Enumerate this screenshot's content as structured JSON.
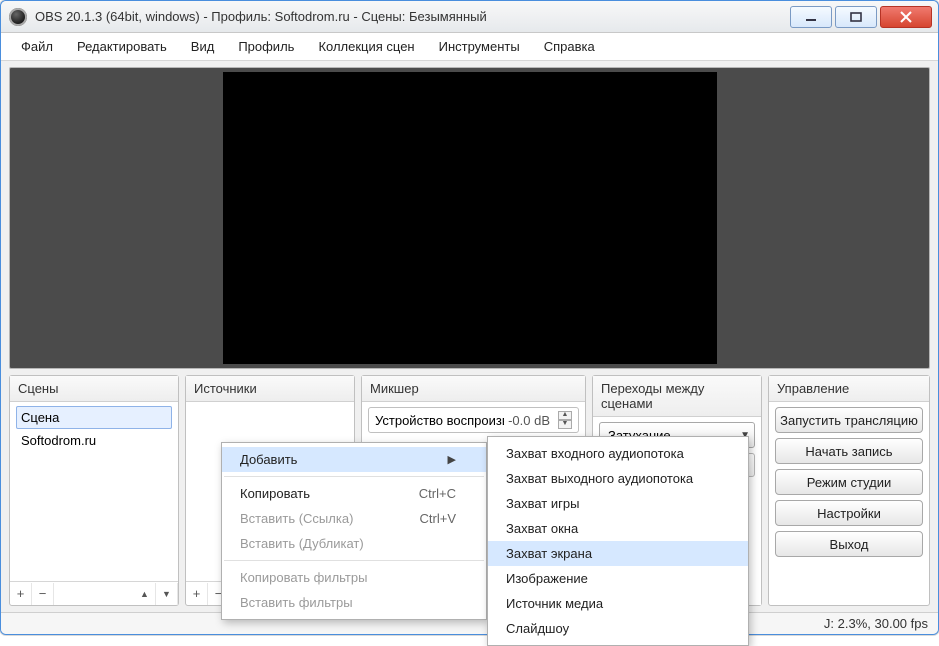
{
  "window": {
    "title": "OBS 20.1.3 (64bit, windows) - Профиль: Softodrom.ru - Сцены: Безымянный"
  },
  "menubar": [
    "Файл",
    "Редактировать",
    "Вид",
    "Профиль",
    "Коллекция сцен",
    "Инструменты",
    "Справка"
  ],
  "panels": {
    "scenes": {
      "title": "Сцены",
      "items": [
        "Сцена",
        "Softodrom.ru"
      ],
      "selected": 0
    },
    "sources": {
      "title": "Источники"
    },
    "mixer": {
      "title": "Микшер",
      "device": "Устройство воспроизведен",
      "db": "-0.0 dB"
    },
    "transitions": {
      "title": "Переходы между сценами",
      "selected": "Затухание"
    },
    "controls": {
      "title": "Управление",
      "buttons": [
        "Запустить трансляцию",
        "Начать запись",
        "Режим студии",
        "Настройки",
        "Выход"
      ]
    }
  },
  "context_menu_1": {
    "items": [
      {
        "label": "Добавить",
        "submenu": true,
        "highlight": true
      },
      {
        "sep": true
      },
      {
        "label": "Копировать",
        "shortcut": "Ctrl+C"
      },
      {
        "label": "Вставить (Ссылка)",
        "shortcut": "Ctrl+V",
        "disabled": true
      },
      {
        "label": "Вставить (Дубликат)",
        "disabled": true
      },
      {
        "sep": true
      },
      {
        "label": "Копировать фильтры",
        "disabled": true
      },
      {
        "label": "Вставить фильтры",
        "disabled": true
      }
    ]
  },
  "context_menu_2": {
    "items": [
      "Захват входного аудиопотока",
      "Захват выходного аудиопотока",
      "Захват игры",
      "Захват окна",
      "Захват экрана",
      "Изображение",
      "Источник медиа",
      "Слайдшоу"
    ],
    "highlight_index": 4
  },
  "statusbar": {
    "text": "J: 2.3%, 30.00 fps"
  },
  "icons": {
    "plus": "+",
    "minus": "−",
    "up": "▲",
    "down": "▼",
    "gear": "⚙"
  }
}
